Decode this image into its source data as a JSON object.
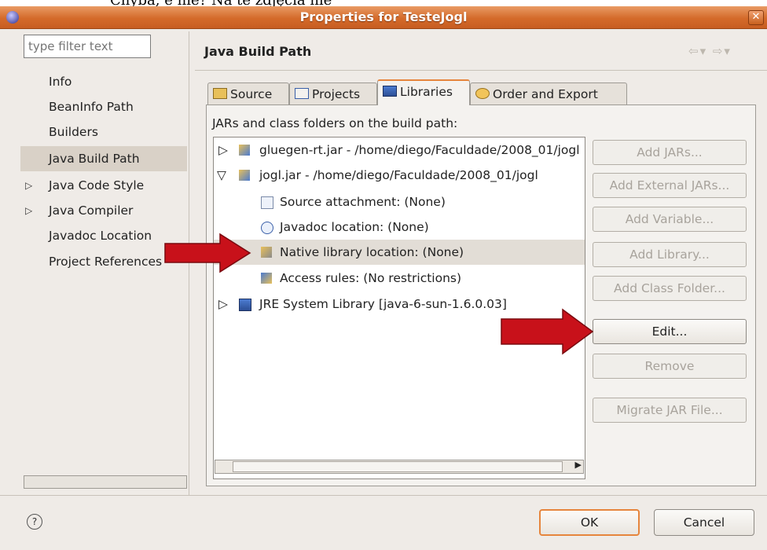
{
  "caption_text": "Chyba, e nie? Na te zdjęcia nie",
  "window": {
    "title": "Properties for TesteJogl"
  },
  "filter": {
    "placeholder": "type filter text"
  },
  "nav": {
    "items": [
      {
        "label": "Info",
        "expandable": false
      },
      {
        "label": "BeanInfo Path",
        "expandable": false
      },
      {
        "label": "Builders",
        "expandable": false
      },
      {
        "label": "Java Build Path",
        "expandable": false,
        "selected": true
      },
      {
        "label": "Java Code Style",
        "expandable": true
      },
      {
        "label": "Java Compiler",
        "expandable": true
      },
      {
        "label": "Javadoc Location",
        "expandable": false
      },
      {
        "label": "Project References",
        "expandable": false
      }
    ]
  },
  "page": {
    "title": "Java Build Path",
    "nav_arrows": "⇦▾ ⇨▾"
  },
  "tabs": [
    {
      "label": "Source",
      "selected": false
    },
    {
      "label": "Projects",
      "selected": false
    },
    {
      "label": "Libraries",
      "selected": true
    },
    {
      "label": "Order and Export",
      "selected": false
    }
  ],
  "libraries": {
    "label": "JARs and class folders on the build path:",
    "rows": [
      {
        "label": "gluegen-rt.jar - /home/diego/Faculdade/2008_01/jogl",
        "expander": "▷"
      },
      {
        "label": "jogl.jar - /home/diego/Faculdade/2008_01/jogl",
        "expander": "▽"
      },
      {
        "label": "Source attachment: (None)",
        "expander": ""
      },
      {
        "label": "Javadoc location: (None)",
        "expander": ""
      },
      {
        "label": "Native library location: (None)",
        "expander": "",
        "selected": true
      },
      {
        "label": "Access rules: (No restrictions)",
        "expander": ""
      },
      {
        "label": "JRE System Library [java-6-sun-1.6.0.03]",
        "expander": "▷"
      }
    ]
  },
  "buttons": {
    "add_jars": "Add JARs...",
    "add_external_jars": "Add External JARs...",
    "add_variable": "Add Variable...",
    "add_library": "Add Library...",
    "add_class_folder": "Add Class Folder...",
    "edit": "Edit...",
    "remove": "Remove",
    "migrate_jar": "Migrate JAR File..."
  },
  "footer": {
    "ok": "OK",
    "cancel": "Cancel",
    "help": "?"
  },
  "colors": {
    "accent": "#e6853d",
    "titlebar": "#d46a2a",
    "arrow": "#c8111a"
  }
}
